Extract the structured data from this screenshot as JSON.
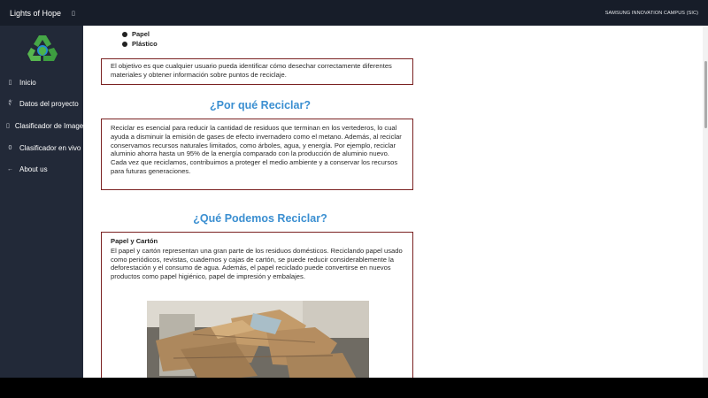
{
  "topbar": {
    "title": "Lights of Hope",
    "menu_icon": "▯",
    "org": "SAMSUNG INNOVATION CAMPUS (SIC)"
  },
  "sidebar": {
    "logo": "recycle-icon",
    "items": [
      {
        "icon": "▯",
        "label": "Inicio"
      },
      {
        "icon": "∜",
        "label": "Datos del proyecto"
      },
      {
        "icon": "▯",
        "label": "Clasificador de Imagen"
      },
      {
        "icon": "0",
        "label": "Clasificador en vivo"
      },
      {
        "icon": "←",
        "label": "About us"
      }
    ]
  },
  "content": {
    "bullets": [
      "Papel",
      "Plástico"
    ],
    "objective": "El objetivo es que cualquier usuario pueda identificar cómo desechar correctamente diferentes materiales y obtener información sobre puntos de reciclaje.",
    "why_heading": "¿Por qué Reciclar?",
    "why_text": "Reciclar es esencial para reducir la cantidad de residuos que terminan en los vertederos, lo cual ayuda a disminuir la emisión de gases de efecto invernadero como el metano. Además, al reciclar conservamos recursos naturales limitados, como árboles, agua, y energía. Por ejemplo, reciclar aluminio ahorra hasta un 95% de la energía comparado con la producción de aluminio nuevo. Cada vez que reciclamos, contribuimos a proteger el medio ambiente y a conservar los recursos para futuras generaciones.",
    "what_heading": "¿Qué Podemos Reciclar?",
    "paper_title": "Papel y Cartón",
    "paper_text": "El papel y cartón representan una gran parte de los residuos domésticos. Reciclando papel usado como periódicos, revistas, cuadernos y cajas de cartón, se puede reducir considerablemente la deforestación y el consumo de agua. Además, el papel reciclado puede convertirse en nuevos productos como papel higiénico, papel de impresión y embalajes."
  }
}
